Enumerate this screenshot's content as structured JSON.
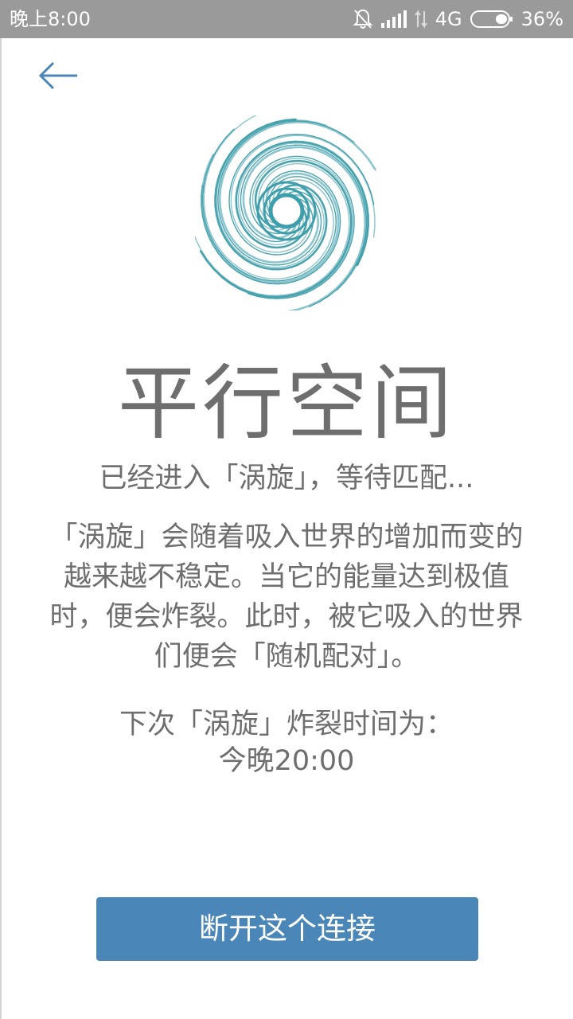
{
  "status_bar": {
    "time": "晚上8:00",
    "network": "4G",
    "battery": "36%"
  },
  "icons": {
    "back": "arrow-left-icon",
    "vortex": "vortex-spiral-icon",
    "mute": "bell-off-icon",
    "signal": "signal-bars-icon",
    "data": "data-arrows-icon",
    "battery": "battery-icon"
  },
  "main": {
    "title": "平行空间",
    "subtitle": "已经进入「涡旋」，等待匹配...",
    "description": "「涡旋」会随着吸入世界的增加而变的越来越不稳定。当它的能量达到极值时，便会炸裂。此时，被它吸入的世界们便会「随机配对」。",
    "next_label": "下次「涡旋」炸裂时间为：",
    "next_time": "今晚20:00"
  },
  "actions": {
    "disconnect_label": "断开这个连接"
  },
  "colors": {
    "status_bar": "#9a9a9a",
    "accent": "#4a87b8",
    "text": "#6e6e6e",
    "vortex": "#3f9eab"
  }
}
